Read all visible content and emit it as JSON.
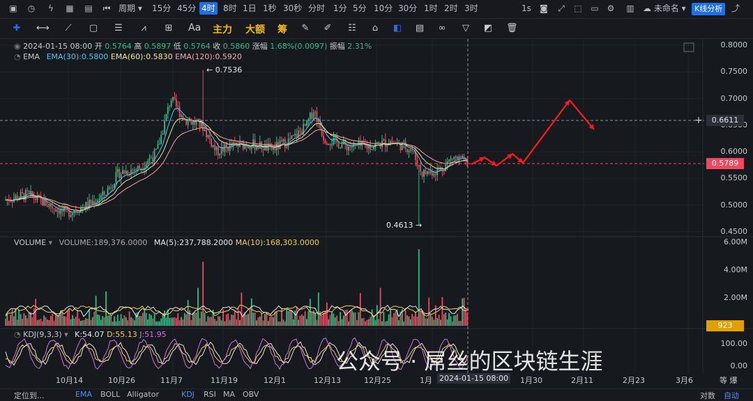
{
  "toolbar": {
    "period_label": "周期",
    "periods": [
      "15分",
      "45分",
      "4时",
      "8时",
      "1日",
      "1秒",
      "30秒",
      "分时",
      "1分",
      "5分",
      "10分",
      "30分",
      "1时",
      "2时",
      "3时"
    ],
    "active_period": "4时",
    "right_interval": "1s",
    "layout_name": "未命名",
    "kline_button": "K线分析"
  },
  "draw_toolbar": {
    "main_force": "主力",
    "big_amount": "大额",
    "chips": "筹",
    "text_tool": "Aa"
  },
  "ohlc": {
    "date": "2024-01-15 08:00",
    "open_label": "开",
    "open": "0.5764",
    "high_label": "高",
    "high": "0.5897",
    "low_label": "低",
    "low": "0.5764",
    "close_label": "收",
    "close": "0.5860",
    "change_label": "涨幅",
    "change": "1.68%(0.0097)",
    "amplitude_label": "振幅",
    "amplitude": "2.31%"
  },
  "ema": {
    "name": "EMA",
    "ema30": "EMA(30):0.5800",
    "ema60": "EMA(60):0.5830",
    "ema120": "EMA(120):0.5920"
  },
  "volume": {
    "name": "VOLUME",
    "value": "VOLUME:189,376.0000",
    "ma5": "MA(5):237,788.2000",
    "ma10": "MA(10):168,303.0000",
    "current_tag": "923",
    "axis": [
      "6.00M",
      "4.00M",
      "2.00M"
    ]
  },
  "kdj": {
    "name": "KDJ(9,3,3)",
    "k": "K:54.07",
    "d": "D:55.13",
    "j": "J:51.95",
    "axis": [
      "100.00",
      "0.00"
    ]
  },
  "price_axis": [
    "0.8000",
    "0.7500",
    "0.7000",
    "0.6500",
    "0.6000",
    "0.5500",
    "0.5000",
    "0.4500"
  ],
  "price_tags": {
    "crosshair": "0.6611",
    "last": "0.5789"
  },
  "annotations": {
    "high": "← 0.7536",
    "low": "0.4613 →"
  },
  "date_axis": [
    "10月14",
    "10月26",
    "11月7",
    "11月19",
    "12月1",
    "12月13",
    "12月25",
    "1月",
    "1月30",
    "2月11",
    "2月23",
    "3月6"
  ],
  "crosshair_date": "2024-01-15 08:00",
  "axis_mode": "等 爆",
  "watermark": "公众号 · 屌丝的区块链生涯",
  "bottom_bar": {
    "locate": "定位到...",
    "indicators": [
      "EMA",
      "BOLL",
      "Alligator",
      "KDJ",
      "RSI",
      "MA",
      "OBV"
    ],
    "log_label": "对数",
    "auto_label": "自动"
  },
  "colors": {
    "up": "#2ebd85",
    "down": "#f6465d",
    "ema30": "#4fc3f7",
    "ema60": "#f0e68c",
    "ema120": "#f3a6a6",
    "accent": "#1f6feb",
    "arrow": "#ff1a1a"
  }
}
